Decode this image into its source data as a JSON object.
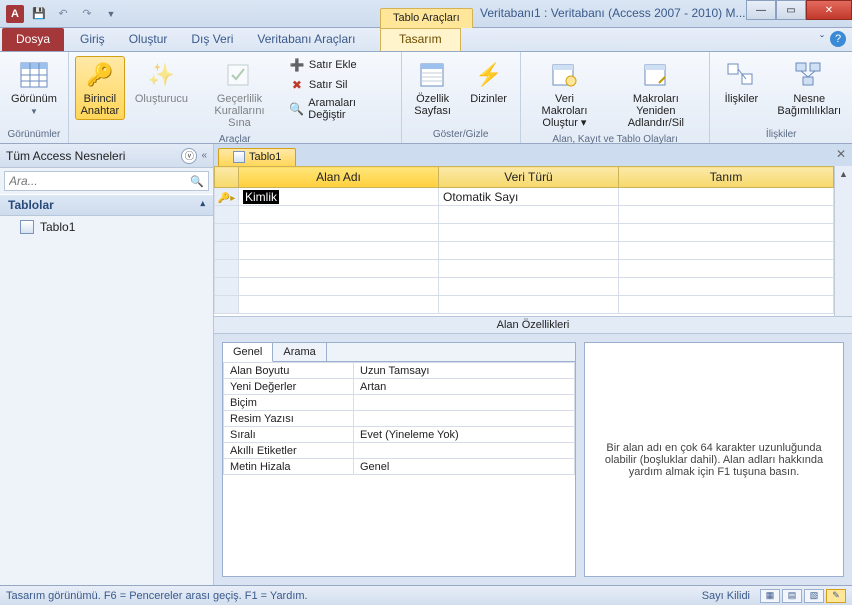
{
  "window": {
    "title": "Veritabanı1 : Veritabanı (Access 2007 - 2010) M...",
    "tools_label": "Tablo Araçları"
  },
  "tabs": {
    "file": "Dosya",
    "home": "Giriş",
    "create": "Oluştur",
    "external": "Dış Veri",
    "dbtools": "Veritabanı Araçları",
    "design": "Tasarım"
  },
  "ribbon": {
    "views_btn": "Görünüm",
    "views_group": "Görünümler",
    "pk_btn": "Birincil\nAnahtar",
    "builder_btn": "Oluşturucu",
    "validation_btn": "Geçerlilik\nKurallarını Sına",
    "insert_rows": "Satır Ekle",
    "delete_rows": "Satır Sil",
    "modify_lookups": "Aramaları Değiştir",
    "tools_group": "Araçlar",
    "prop_sheet": "Özellik\nSayfası",
    "indexes": "Dizinler",
    "showhide_group": "Göster/Gizle",
    "create_macros": "Veri Makroları\nOluştur ▾",
    "rename_macros": "Makroları Yeniden\nAdlandır/Sil",
    "events_group": "Alan, Kayıt ve Tablo Olayları",
    "relationships": "İlişkiler",
    "obj_deps": "Nesne\nBağımlılıkları",
    "rel_group": "İlişkiler"
  },
  "nav": {
    "header": "Tüm Access Nesneleri",
    "search_placeholder": "Ara...",
    "section": "Tablolar",
    "item1": "Tablo1"
  },
  "doc": {
    "tab": "Tablo1",
    "col_name": "Alan Adı",
    "col_type": "Veri Türü",
    "col_desc": "Tanım",
    "row1_name": "Kimlik",
    "row1_type": "Otomatik Sayı"
  },
  "props": {
    "caption": "Alan Özellikleri",
    "tab_general": "Genel",
    "tab_lookup": "Arama",
    "rows": [
      {
        "k": "Alan Boyutu",
        "v": "Uzun Tamsayı"
      },
      {
        "k": "Yeni Değerler",
        "v": "Artan"
      },
      {
        "k": "Biçim",
        "v": ""
      },
      {
        "k": "Resim Yazısı",
        "v": ""
      },
      {
        "k": "Sıralı",
        "v": "Evet (Yineleme Yok)"
      },
      {
        "k": "Akıllı Etiketler",
        "v": ""
      },
      {
        "k": "Metin Hizala",
        "v": "Genel"
      }
    ],
    "help": "Bir alan adı en çok 64 karakter uzunluğunda olabilir (boşluklar dahil). Alan adları hakkında yardım almak için F1 tuşuna basın."
  },
  "status": {
    "left": "Tasarım görünümü.  F6 = Pencereler arası geçiş.  F1 = Yardım.",
    "numlock": "Sayı Kilidi"
  }
}
